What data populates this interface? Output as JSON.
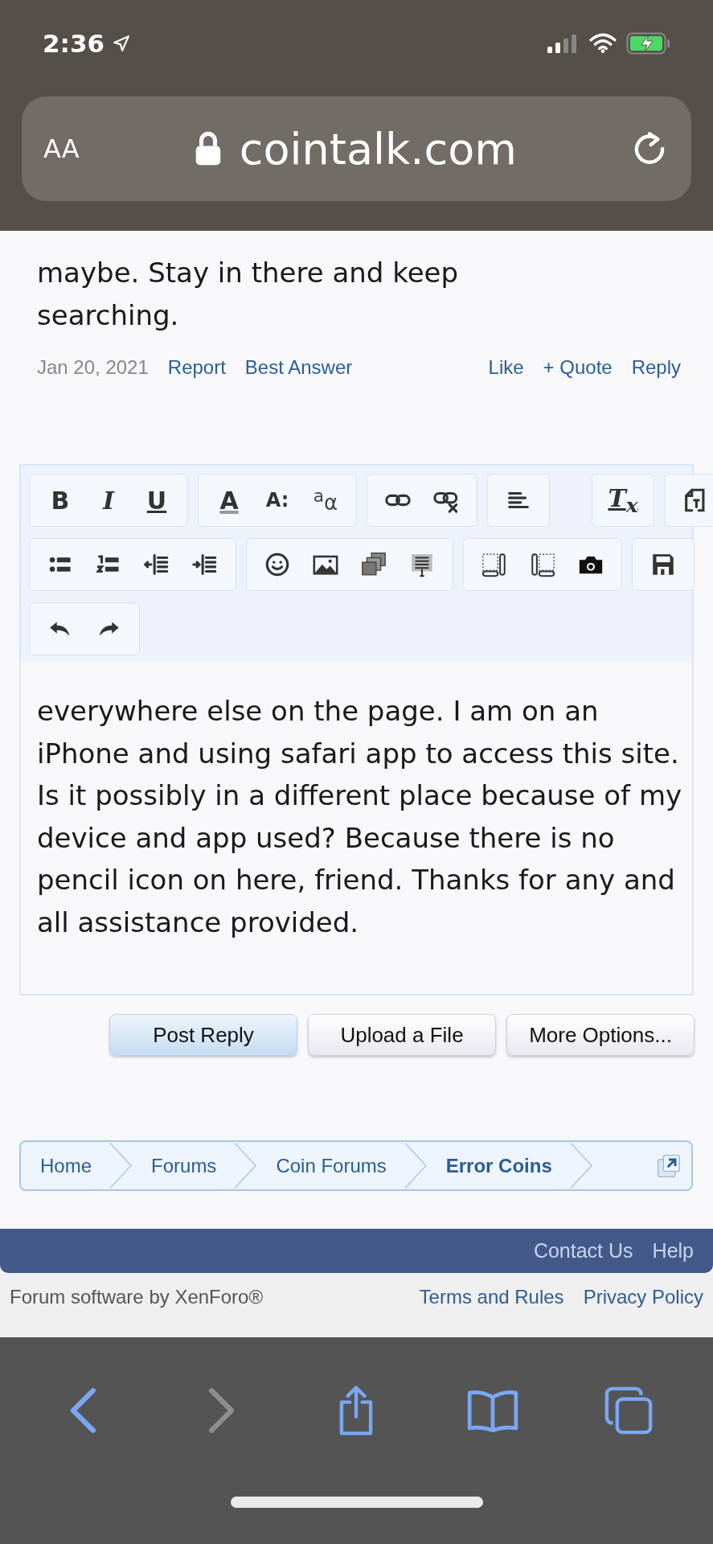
{
  "status_bar": {
    "time": "2:36"
  },
  "address_bar": {
    "text_size_label": "AA",
    "url": "cointalk.com"
  },
  "post": {
    "text": "maybe. Stay in there and keep searching.",
    "date": "Jan 20, 2021",
    "left_links": [
      "Report",
      "Best Answer"
    ],
    "right_links": [
      "Like",
      "+ Quote",
      "Reply"
    ]
  },
  "editor": {
    "toolbar_rows": [
      [
        [
          {
            "kind": "bold",
            "label": "B"
          },
          {
            "kind": "italic",
            "label": "I"
          },
          {
            "kind": "underline",
            "label": "U"
          }
        ],
        [
          {
            "kind": "color",
            "label": "A"
          },
          {
            "kind": "size",
            "label": "A:"
          },
          {
            "kind": "case",
            "label": "$^{a}$α"
          }
        ],
        [
          {
            "kind": "icon"
          },
          {
            "kind": "icon"
          }
        ],
        [
          {
            "kind": "icon"
          }
        ],
        [
          {
            "kind": "clear",
            "label": "T$_{x}$"
          }
        ],
        [
          {
            "kind": "icon"
          }
        ]
      ],
      [
        [
          {
            "kind": "icon"
          },
          {
            "kind": "icon"
          },
          {
            "kind": "icon"
          },
          {
            "kind": "icon"
          }
        ],
        [
          {
            "kind": "icon"
          },
          {
            "kind": "icon"
          },
          {
            "kind": "icon"
          },
          {
            "kind": "icon"
          }
        ],
        [
          {
            "kind": "icon"
          },
          {
            "kind": "icon"
          },
          {
            "kind": "icon"
          }
        ],
        [
          {
            "kind": "icon"
          }
        ]
      ],
      [
        [
          {
            "kind": "icon"
          },
          {
            "kind": "icon"
          }
        ]
      ]
    ],
    "text": "everywhere else on the page. I am on an iPhone and using safari app to access this site. Is it possibly in a different place because of my device and app used? Because there is no pencil icon on here, friend. Thanks for any and all assistance provided."
  },
  "buttons": [
    {
      "label": "Post Reply",
      "primary": true
    },
    {
      "label": "Upload a File",
      "primary": false
    },
    {
      "label": "More Options...",
      "primary": false
    }
  ],
  "breadcrumb": [
    {
      "label": "Home",
      "current": false
    },
    {
      "label": "Forums",
      "current": false
    },
    {
      "label": "Coin Forums",
      "current": false
    },
    {
      "label": "Error Coins",
      "current": true
    }
  ],
  "footer": {
    "links": [
      "Contact Us",
      "Help"
    ],
    "credit": "Forum software by XenForo®",
    "legal_links": [
      "Terms and Rules",
      "Privacy Policy"
    ]
  },
  "browser_toolbar": {
    "back_disabled": false,
    "forward_disabled": true
  }
}
